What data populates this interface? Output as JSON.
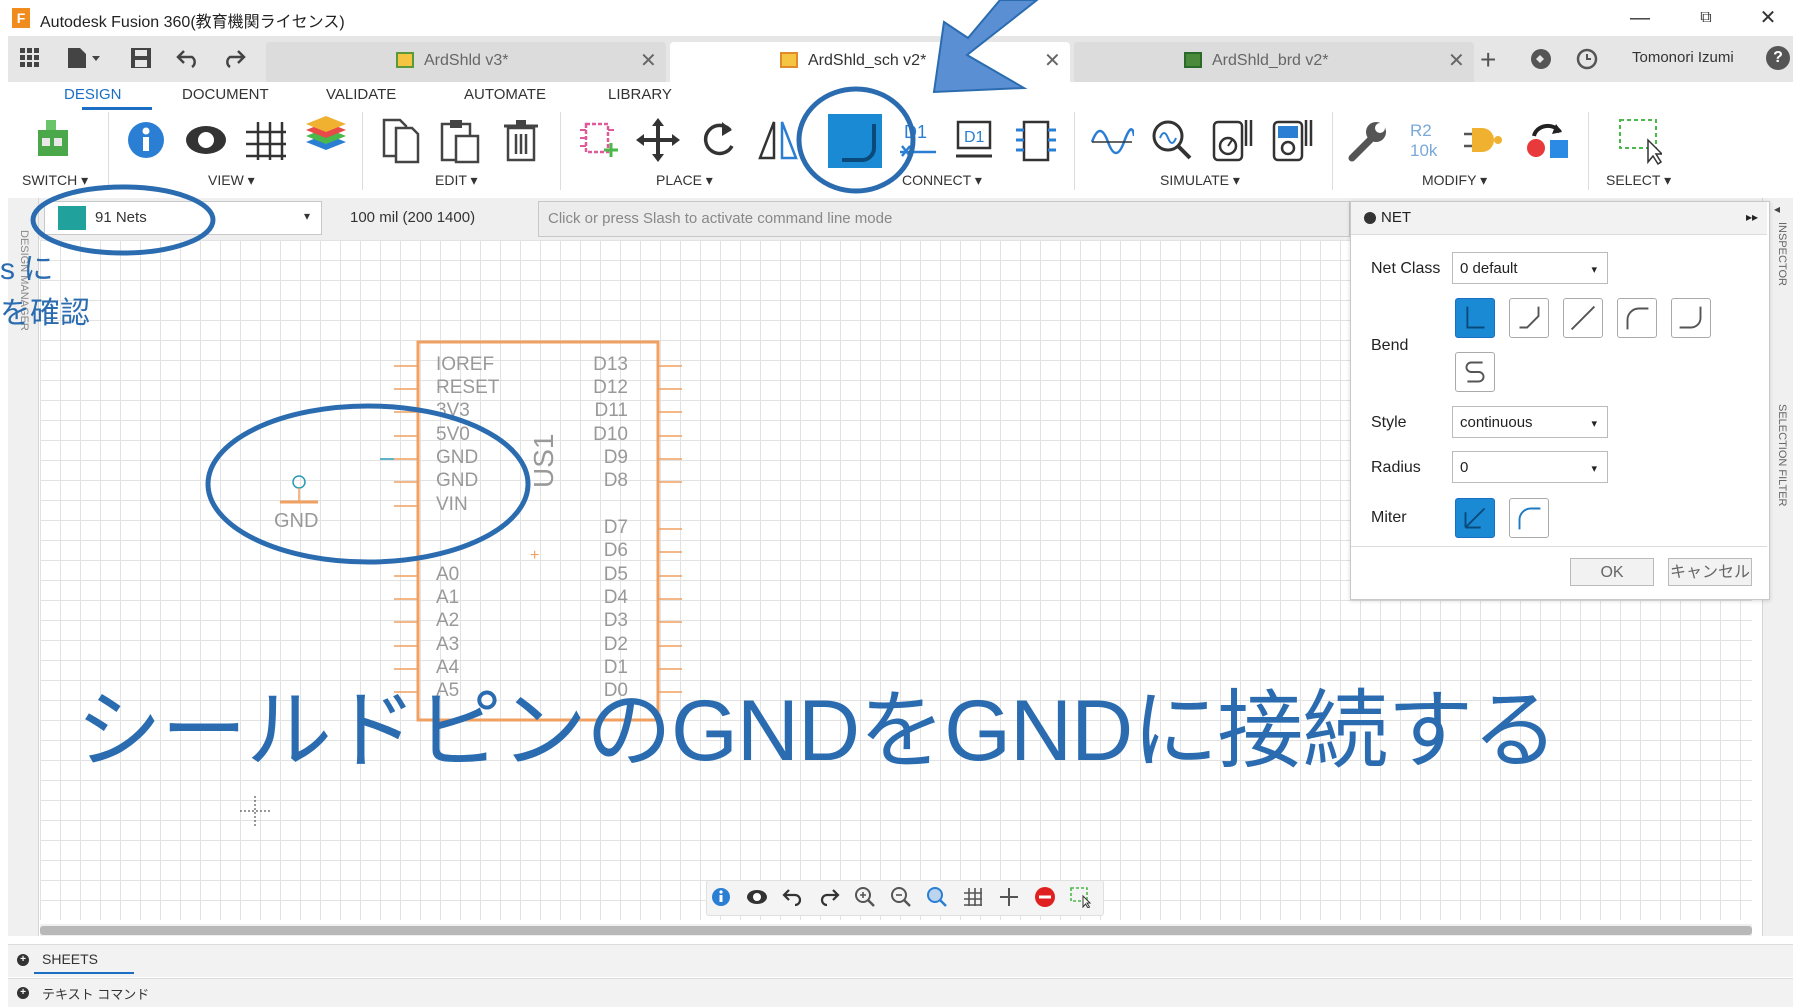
{
  "window": {
    "title": "Autodesk Fusion 360(教育機関ライセンス)",
    "logo": "F",
    "minimize": "—",
    "restore": "⧉",
    "close": "✕"
  },
  "tabs": [
    {
      "label": "ArdShld v3*",
      "close": "✕"
    },
    {
      "label": "ArdShld_sch v2*",
      "close": "✕"
    },
    {
      "label": "ArdShld_brd v2*",
      "close": "✕"
    }
  ],
  "user": {
    "name": "Tomonori Izumi",
    "help": "?"
  },
  "ribbon_tabs": [
    "DESIGN",
    "DOCUMENT",
    "VALIDATE",
    "AUTOMATE",
    "LIBRARY"
  ],
  "ribbon_groups": {
    "switch": "SWITCH ▾",
    "view": "VIEW ▾",
    "edit": "EDIT ▾",
    "place": "PLACE ▾",
    "connect": "CONNECT ▾",
    "simulate": "SIMULATE ▾",
    "modify": "MODIFY ▾",
    "select": "SELECT ▾"
  },
  "ribbon_icon_text": {
    "d1": "D1",
    "r2": "R2",
    "r2_val": "10k"
  },
  "net_selector": {
    "label": "91 Nets",
    "caret": "▾",
    "swatch_color": "#21a19b"
  },
  "coordinates": "100 mil (200 1400)",
  "command_line": {
    "placeholder": "Click or press Slash to activate command line mode"
  },
  "left_panel_label": "DESIGN MANAGER",
  "right_panel_labels": [
    "INSPECTOR",
    "SELECTION FILTER"
  ],
  "right_panel_arrow": "◂",
  "left_panel_arrow": "▸▸",
  "net_dialog": {
    "title": "NET",
    "collapse": "▸▸",
    "net_class_label": "Net Class",
    "net_class_value": "0 default",
    "bend_label": "Bend",
    "style_label": "Style",
    "style_value": "continuous",
    "radius_label": "Radius",
    "radius_value": "0",
    "miter_label": "Miter",
    "ok": "OK",
    "cancel": "キャンセル",
    "caret": "▾"
  },
  "schematic": {
    "part_name": "US1",
    "left_pins": [
      "IOREF",
      "RESET",
      "3V3",
      "5V0",
      "GND",
      "GND",
      "VIN",
      "",
      "",
      "A0",
      "A1",
      "A2",
      "A3",
      "A4",
      "A5"
    ],
    "right_pins": [
      "D13",
      "D12",
      "D11",
      "D10",
      "D9",
      "D8",
      "",
      "D7",
      "D6",
      "D5",
      "D4",
      "D3",
      "D2",
      "D1",
      "D0"
    ],
    "gnd_symbol": "GND",
    "part_color": "#f0a060"
  },
  "sheets_label": "SHEETS",
  "text_command_label": "テキスト コマンド",
  "annotations": {
    "main": "シールドピンのGNDをGNDに接続する",
    "side_line1": "s に",
    "side_line2": "を確認",
    "color": "#2b6cb0"
  }
}
